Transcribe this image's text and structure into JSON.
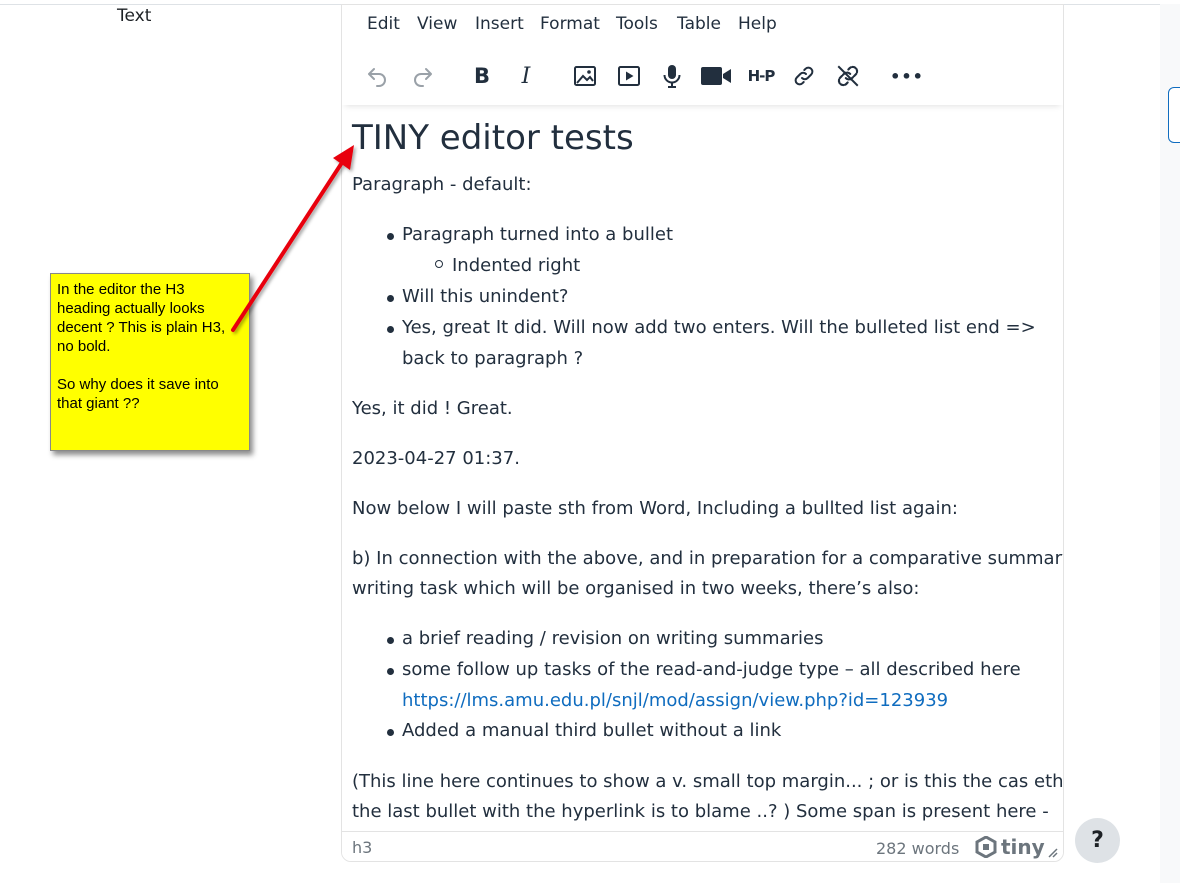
{
  "field": {
    "label": "Text"
  },
  "menu": [
    "Edit",
    "View",
    "Insert",
    "Format",
    "Tools",
    "Table",
    "Help"
  ],
  "toolbar_icons": [
    "undo-icon",
    "redo-icon",
    "bold-icon",
    "italic-icon",
    "image-icon",
    "media-icon",
    "microphone-icon",
    "video-camera-icon",
    "h5p-icon",
    "link-icon",
    "unlink-icon",
    "more-icon"
  ],
  "toolbar": {
    "bold": "B",
    "italic": "I",
    "h5p": "H-P",
    "more": "•••"
  },
  "content": {
    "heading": "TINY editor tests",
    "p1": "Paragraph - default:",
    "list1": [
      "Paragraph turned into a bullet",
      "Indented right",
      "Will this unindent?",
      "Yes, great It did. Will now add two enters. Will the bulleted list end =>",
      "back to paragraph ?"
    ],
    "p2": "Yes, it did ! Great.",
    "p3": "2023-04-27 01:37.",
    "p4": "Now below I will paste sth from Word, Including a bullted list again:",
    "p5_line1": "b) In connection with the above, and in preparation for a comparative summary",
    "p5_line2": "writing task which will be organised in two weeks, there’s also:",
    "list2": [
      "a brief reading / revision on writing summaries",
      "some follow up tasks of the read-and-judge type – all described here",
      "https://lms.amu.edu.pl/snjl/mod/assign/view.php?id=123939",
      "Added a manual third bullet without a link"
    ],
    "p6_line1": "(This line here continues to show a v. small top margin... ; or is this the cas ethat",
    "p6_line2": "the last bullet with the hyperlink is to blame ..? ) Some span is present here -"
  },
  "status": {
    "path": "h3",
    "wordcount": "282 words",
    "brand": "tiny"
  },
  "note": {
    "text": "In the editor the H3\nheading actually looks\ndecent ? This is plain H3,\nno bold.\n\nSo why does it save into\nthat giant ??"
  },
  "help": {
    "label": "?"
  },
  "colors": {
    "text": "#222f3e",
    "link": "#0f6cbf",
    "note": "#ffff00",
    "arrow": "#e8000b"
  }
}
